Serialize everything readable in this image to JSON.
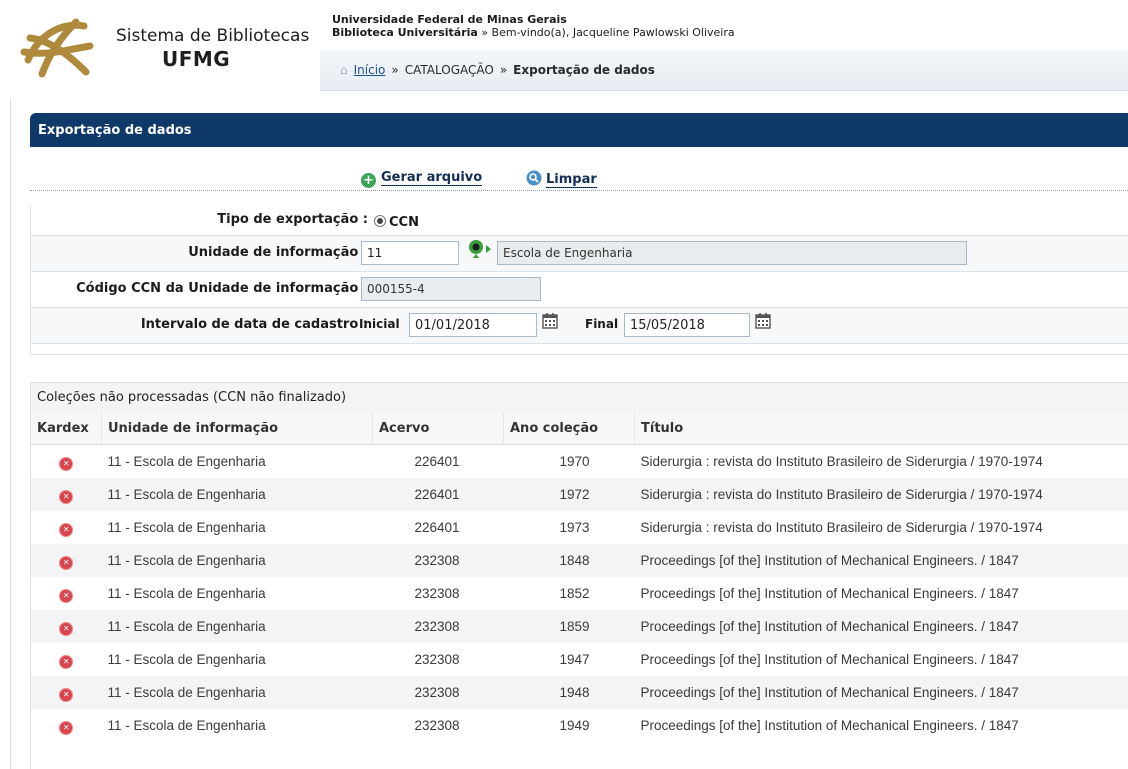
{
  "header": {
    "brand_line1": "Sistema de Bibliotecas",
    "brand_line2": "UFMG",
    "university": "Universidade Federal de Minas Gerais",
    "library": "Biblioteca Universitária",
    "welcome": "» Bem-vindo(a), Jacqueline Pawlowski Oliveira"
  },
  "breadcrumb": {
    "home": "Início",
    "sep": "»",
    "level1": "CATALOGAÇÃO",
    "current": "Exportação de dados"
  },
  "panel": {
    "title": "Exportação de dados"
  },
  "toolbar": {
    "generate": "Gerar arquivo",
    "clear": "Limpar"
  },
  "form": {
    "tipo_label": "Tipo de exportação :",
    "tipo_value": "CCN",
    "unidade_label": "Unidade de informação :",
    "unidade_code": "11",
    "unidade_name": "Escola de Engenharia",
    "ccn_label": "Código CCN da Unidade de informação :",
    "ccn_value": "000155-4",
    "intervalo_label": "Intervalo de data de cadastro :",
    "inicial_label": "Inicial",
    "inicial_value": "01/01/2018",
    "final_label": "Final",
    "final_value": "15/05/2018"
  },
  "table": {
    "caption": "Coleções não processadas (CCN não finalizado)",
    "columns": [
      "Kardex",
      "Unidade de informação",
      "Acervo",
      "Ano coleção",
      "Título"
    ],
    "rows": [
      {
        "unidade": "11 - Escola de Engenharia",
        "acervo": "226401",
        "ano": "1970",
        "titulo": "Siderurgia : revista do Instituto Brasileiro de Siderurgia / 1970-1974"
      },
      {
        "unidade": "11 - Escola de Engenharia",
        "acervo": "226401",
        "ano": "1972",
        "titulo": "Siderurgia : revista do Instituto Brasileiro de Siderurgia / 1970-1974"
      },
      {
        "unidade": "11 - Escola de Engenharia",
        "acervo": "226401",
        "ano": "1973",
        "titulo": "Siderurgia : revista do Instituto Brasileiro de Siderurgia / 1970-1974"
      },
      {
        "unidade": "11 - Escola de Engenharia",
        "acervo": "232308",
        "ano": "1848",
        "titulo": "Proceedings [of the] Institution of Mechanical Engineers. / 1847"
      },
      {
        "unidade": "11 - Escola de Engenharia",
        "acervo": "232308",
        "ano": "1852",
        "titulo": "Proceedings [of the] Institution of Mechanical Engineers. / 1847"
      },
      {
        "unidade": "11 - Escola de Engenharia",
        "acervo": "232308",
        "ano": "1859",
        "titulo": "Proceedings [of the] Institution of Mechanical Engineers. / 1847"
      },
      {
        "unidade": "11 - Escola de Engenharia",
        "acervo": "232308",
        "ano": "1947",
        "titulo": "Proceedings [of the] Institution of Mechanical Engineers. / 1847"
      },
      {
        "unidade": "11 - Escola de Engenharia",
        "acervo": "232308",
        "ano": "1948",
        "titulo": "Proceedings [of the] Institution of Mechanical Engineers. / 1847"
      },
      {
        "unidade": "11 - Escola de Engenharia",
        "acervo": "232308",
        "ano": "1949",
        "titulo": "Proceedings [of the] Institution of Mechanical Engineers. / 1847"
      }
    ]
  },
  "icons": {
    "logo": "knot-logo",
    "home": "home-icon",
    "generate": "plus-circle-icon",
    "clear": "magnifier-icon",
    "lookup": "lookup-icon",
    "calendar": "calendar-icon",
    "kardex": "kardex-icon"
  },
  "colors": {
    "panel_header": "#0e3968",
    "logo": "#b08a3c",
    "generate_icon": "#3aa655",
    "clear_icon": "#4a90c8",
    "kardex_icon": "#d9454e"
  }
}
